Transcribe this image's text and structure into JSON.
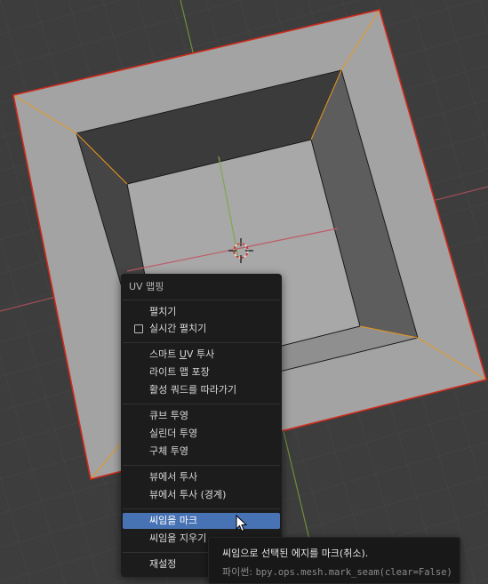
{
  "menu": {
    "title": "UV 맵핑",
    "items": [
      {
        "label": "펼치기"
      },
      {
        "label": "실시간 펼치기",
        "checkbox": true,
        "checked": false
      },
      {
        "label_pre": "스마트 ",
        "label_ul": "U",
        "label_post": "V 투사"
      },
      {
        "label": "라이트 맵 포장"
      },
      {
        "label": "활성 쿼드를 따라가기"
      },
      {
        "label": "큐브 투영"
      },
      {
        "label": "실린더 투영"
      },
      {
        "label": "구체 투영"
      },
      {
        "label": "뷰에서 투사"
      },
      {
        "label": "뷰에서 투사 (경계)"
      },
      {
        "label": "씨임을 마크",
        "highlighted": true
      },
      {
        "label": "씨임을 지우기"
      },
      {
        "label": "재설정"
      }
    ]
  },
  "tooltip": {
    "description": "씨임으로 선택된 에지를 마크(취소).",
    "python_label": "파이썬:",
    "python_code": "bpy.ops.mesh.mark_seam(clear=False)"
  },
  "colors": {
    "menu_bg": "#1c1c1c",
    "highlight": "#4772b3",
    "viewport_bg": "#3d3d3d",
    "selection_outline": "#e8961a"
  }
}
